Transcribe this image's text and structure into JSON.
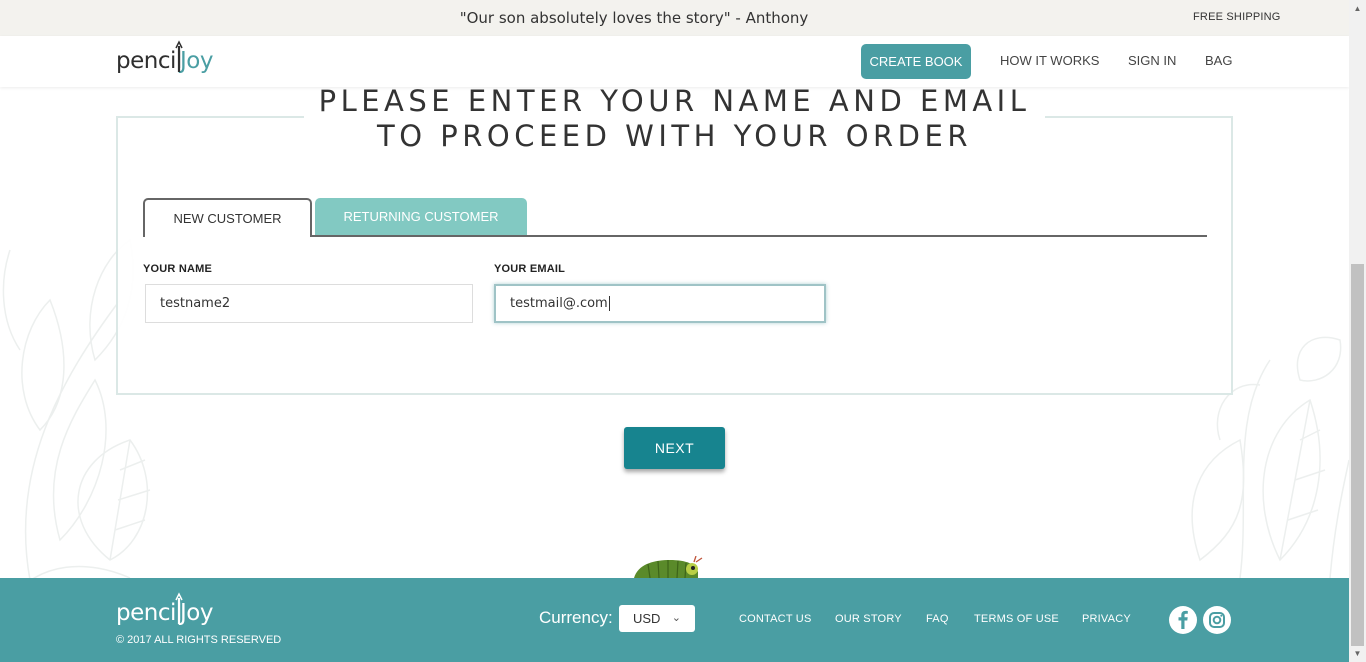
{
  "promo": {
    "quote": "\"Our son absolutely loves the story\" - Anthony",
    "shipping": "FREE SHIPPING"
  },
  "header": {
    "logo_text": "penciljoy",
    "nav": {
      "create_book": "CREATE BOOK",
      "how_it_works": "HOW IT WORKS",
      "sign_in": "SIGN IN",
      "bag": "BAG"
    }
  },
  "form": {
    "heading_line1": "PLEASE ENTER YOUR NAME AND EMAIL",
    "heading_line2": "TO PROCEED WITH YOUR ORDER",
    "tabs": {
      "new_customer": "NEW CUSTOMER",
      "returning_customer": "RETURNING CUSTOMER"
    },
    "name_label": "YOUR NAME",
    "name_value": "testname2",
    "email_label": "YOUR EMAIL",
    "email_value": "testmail@.com",
    "next_label": "NEXT"
  },
  "footer": {
    "logo_text": "penciljoy",
    "copyright": "© 2017 ALL RIGHTS RESERVED",
    "currency_label": "Currency:",
    "currency_value": "USD",
    "links": {
      "contact": "CONTACT US",
      "story": "OUR STORY",
      "faq": "FAQ",
      "terms": "TERMS OF USE",
      "privacy": "PRIVACY"
    }
  },
  "colors": {
    "brand_teal": "#4a9ea3",
    "next_button": "#17848f",
    "returning_tab": "#82c9c2",
    "promo_bg": "#f3f2ee"
  },
  "icons": [
    "facebook-icon",
    "instagram-icon",
    "chevron-down-icon",
    "caterpillar-illustration"
  ]
}
